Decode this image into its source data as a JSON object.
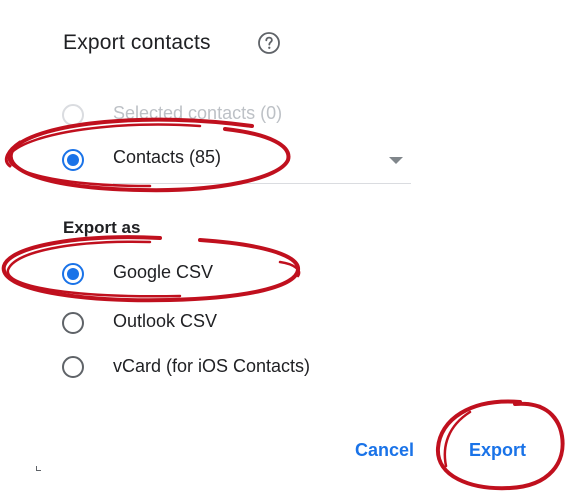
{
  "dialog": {
    "title": "Export contacts",
    "help_icon": "help-circle-icon"
  },
  "selection": {
    "options": [
      {
        "label": "Selected contacts (0)",
        "checked": false,
        "disabled": true
      },
      {
        "label": "Contacts (85)",
        "checked": true,
        "disabled": false
      }
    ],
    "dropdown_icon": "dropdown-arrow-icon"
  },
  "format": {
    "heading": "Export as",
    "options": [
      {
        "label": "Google CSV",
        "checked": true
      },
      {
        "label": "Outlook CSV",
        "checked": false
      },
      {
        "label": "vCard (for iOS Contacts)",
        "checked": false
      }
    ]
  },
  "actions": {
    "cancel_label": "Cancel",
    "export_label": "Export"
  },
  "annotation": {
    "ink_color": "#c0101e"
  },
  "colors": {
    "accent": "#1a73e8",
    "text": "#202124",
    "disabled_text": "#bdc1c6"
  }
}
